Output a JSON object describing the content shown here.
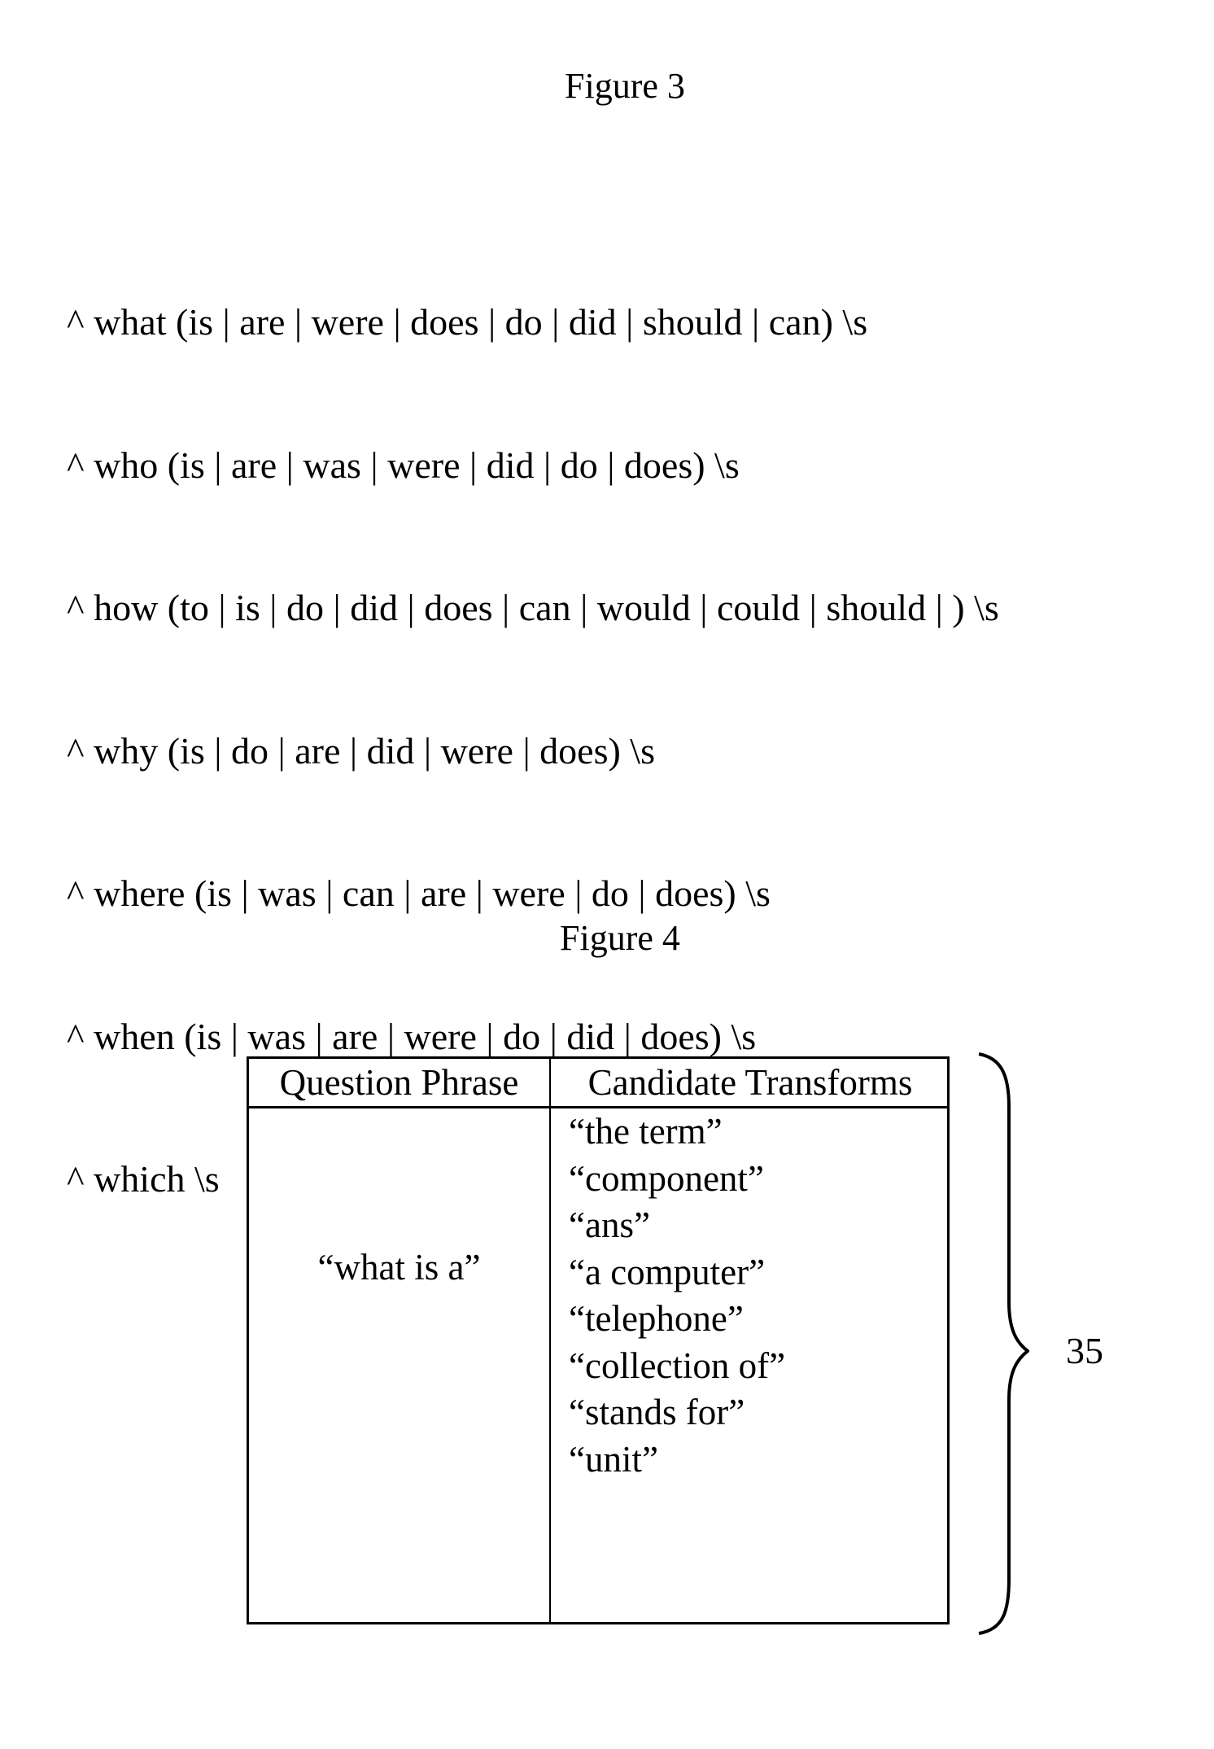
{
  "figure3": {
    "title": "Figure 3",
    "lines": [
      "^ what (is | are | were | does | do | did | should | can) \\s",
      "^ who (is | are | was | were | did | do | does) \\s",
      "^ how (to | is | do | did | does | can | would | could | should | ) \\s",
      "^ why (is | do | are | did | were | does) \\s",
      "^ where (is | was | can | are | were | do | does) \\s",
      "^ when (is | was | are | were | do | did | does) \\s",
      "^ which \\s"
    ]
  },
  "figure4": {
    "title": "Figure 4",
    "table": {
      "headers": [
        "Question Phrase",
        "Candidate Transforms"
      ],
      "question_phrase": "“what is a”",
      "candidate_transforms": [
        "“the term”",
        "“component”",
        "“ans”",
        "“a computer”",
        "“telephone”",
        "“collection of”",
        "“stands for”",
        "“unit”"
      ]
    },
    "reference_numeral": "35"
  }
}
